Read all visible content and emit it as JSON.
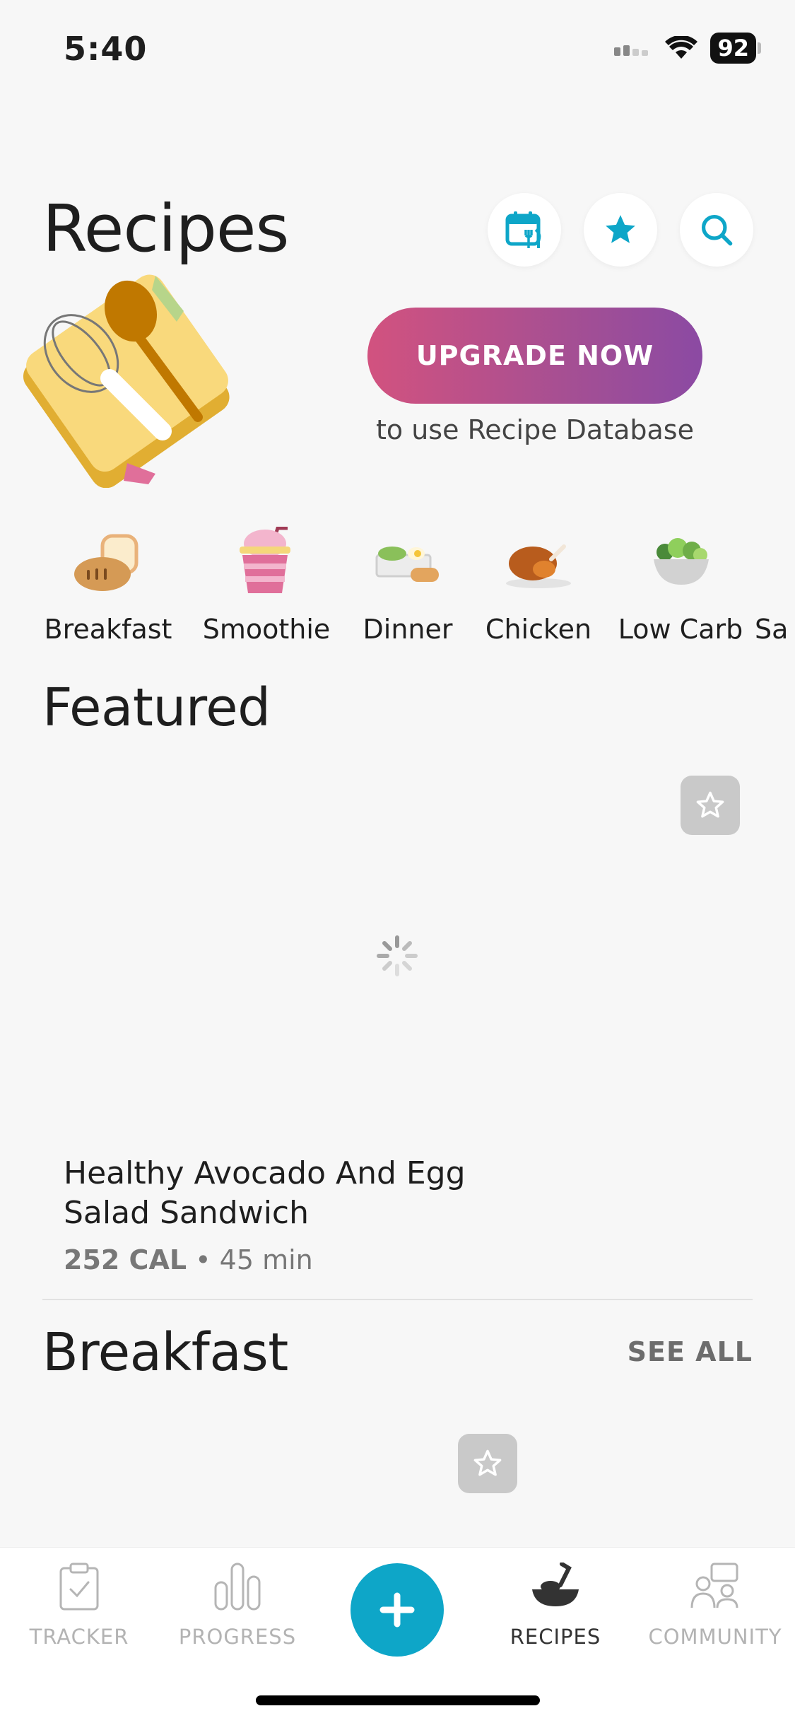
{
  "status": {
    "time": "5:40",
    "battery": "92"
  },
  "header": {
    "title": "Recipes"
  },
  "promo": {
    "button": "UPGRADE NOW",
    "subtitle": "to use Recipe Database"
  },
  "categories": [
    {
      "label": "Breakfast",
      "icon": "bread-icon"
    },
    {
      "label": "Smoothie",
      "icon": "smoothie-icon"
    },
    {
      "label": "Dinner",
      "icon": "dinner-plate-icon"
    },
    {
      "label": "Chicken",
      "icon": "roast-chicken-icon"
    },
    {
      "label": "Low Carb",
      "icon": "salad-bowl-icon"
    },
    {
      "label": "Sa",
      "icon": "category-icon"
    }
  ],
  "featured": {
    "heading": "Featured",
    "recipe": {
      "title_line1": "Healthy Avocado And Egg",
      "title_line2": "Salad Sandwich",
      "calories": "252 CAL",
      "separator": "•",
      "time": "45 min"
    }
  },
  "breakfast": {
    "heading": "Breakfast",
    "see_all": "SEE ALL"
  },
  "tabbar": {
    "tracker": "TRACKER",
    "progress": "PROGRESS",
    "recipes": "RECIPES",
    "community": "COMMUNITY"
  },
  "colors": {
    "accent": "#0ea6c8",
    "upgrade_start": "#d2527f",
    "upgrade_end": "#8b4aa3"
  }
}
